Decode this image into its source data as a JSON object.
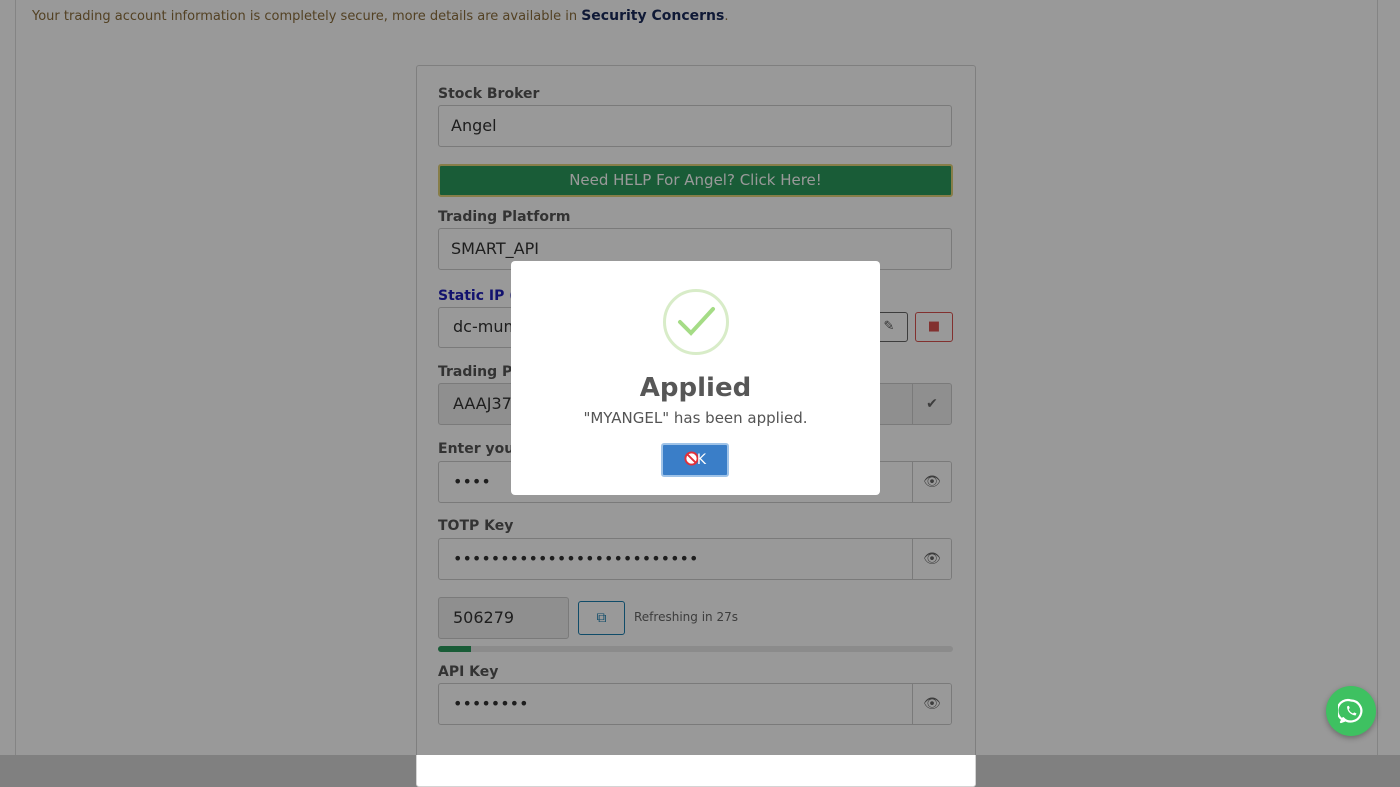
{
  "notice": {
    "text": "Your trading account information is completely secure, more details are available in ",
    "link": "Security Concerns",
    "end": "."
  },
  "form": {
    "broker_label": "Stock Broker",
    "broker_value": "Angel",
    "help_button": "Need HELP For Angel? Click Here!",
    "platform_label": "Trading Platform",
    "platform_value": "SMART_API",
    "static_ip_label": "Static IP (1",
    "static_ip_value": "dc-mum",
    "trading_pl_label": "Trading Pla",
    "trading_pl_value": "AAAJ371",
    "enter_label": "Enter your",
    "password_value": "••••",
    "totp_label": "TOTP Key",
    "totp_key_value": "••••••••••••••••••••••••••",
    "totp_code": "506279",
    "refresh_text": "Refreshing in 27s",
    "refresh_progress": 0.065,
    "api_label": "API Key",
    "api_value": "••••••••"
  },
  "modal": {
    "title": "Applied",
    "message": "\"MYANGEL\" has been applied.",
    "ok_label": "K"
  },
  "colors": {
    "help_green": "#2a9a5c",
    "ok_blue": "#3a7ec8",
    "whatsapp_green": "#3ec161"
  }
}
